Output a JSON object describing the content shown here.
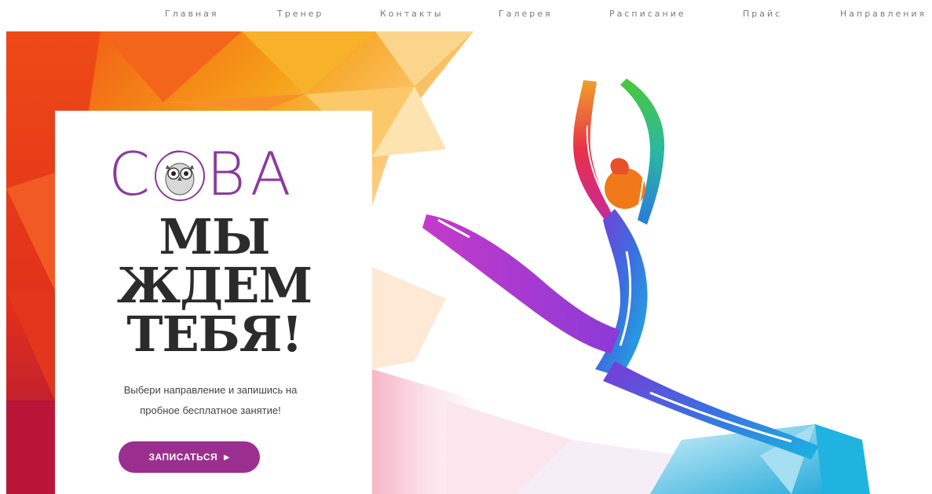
{
  "nav": {
    "items": [
      "Главная",
      "Тренер",
      "Контакты",
      "Галерея",
      "Расписание",
      "Прайс",
      "Направления"
    ]
  },
  "hero": {
    "logo": {
      "text": "СОВА",
      "brand_color": "#8b3a9e"
    },
    "headline": [
      "МЫ",
      "ЖДЕМ",
      "ТЕБЯ!"
    ],
    "subtext": [
      "Выбери направление и запишись на",
      "пробное бесплатное занятие!"
    ],
    "cta": {
      "label": "ЗАПИСАТЬСЯ",
      "icon": "caret-right-icon",
      "color": "#9b2f8f"
    },
    "image": "dancer-illustration"
  },
  "colors": {
    "accent": "#9b2f8f",
    "nav_text": "#7a7a7a",
    "headline": "#2b2b2b"
  }
}
